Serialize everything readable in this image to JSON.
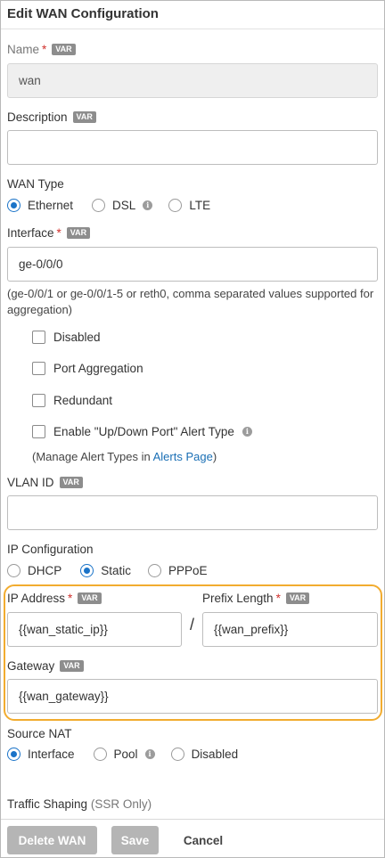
{
  "dialog": {
    "title": "Edit WAN Configuration"
  },
  "var_badge": "VAR",
  "required_mark": "*",
  "name": {
    "label": "Name",
    "value": "wan"
  },
  "description": {
    "label": "Description",
    "value": ""
  },
  "wan_type": {
    "label": "WAN Type",
    "options": [
      "Ethernet",
      "DSL",
      "LTE"
    ],
    "selected": "Ethernet"
  },
  "interface": {
    "label": "Interface",
    "value": "ge-0/0/0",
    "hint": "(ge-0/0/1 or ge-0/0/1-5 or reth0, comma separated values supported for aggregation)"
  },
  "checkboxes": {
    "disabled": "Disabled",
    "port_aggregation": "Port Aggregation",
    "redundant": "Redundant",
    "alert_type": "Enable \"Up/Down Port\" Alert Type"
  },
  "alert_hint": {
    "prefix": "(Manage Alert Types in ",
    "link": "Alerts Page",
    "suffix": ")"
  },
  "vlan": {
    "label": "VLAN ID",
    "value": ""
  },
  "ip_config": {
    "label": "IP Configuration",
    "options": [
      "DHCP",
      "Static",
      "PPPoE"
    ],
    "selected": "Static"
  },
  "ip_address": {
    "label": "IP Address",
    "value": "{{wan_static_ip}}"
  },
  "separator": "/",
  "prefix_length": {
    "label": "Prefix Length",
    "value": "{{wan_prefix}}"
  },
  "gateway": {
    "label": "Gateway",
    "value": "{{wan_gateway}}"
  },
  "source_nat": {
    "label": "Source NAT",
    "options": [
      "Interface",
      "Pool",
      "Disabled"
    ],
    "selected": "Interface"
  },
  "traffic_shaping": {
    "label": "Traffic Shaping",
    "suffix": "(SSR Only)"
  },
  "buttons": {
    "delete": "Delete WAN",
    "save": "Save",
    "cancel": "Cancel"
  },
  "colors": {
    "accent": "#1a73c8",
    "highlight": "#f2ac2f",
    "required": "#d0312d"
  }
}
